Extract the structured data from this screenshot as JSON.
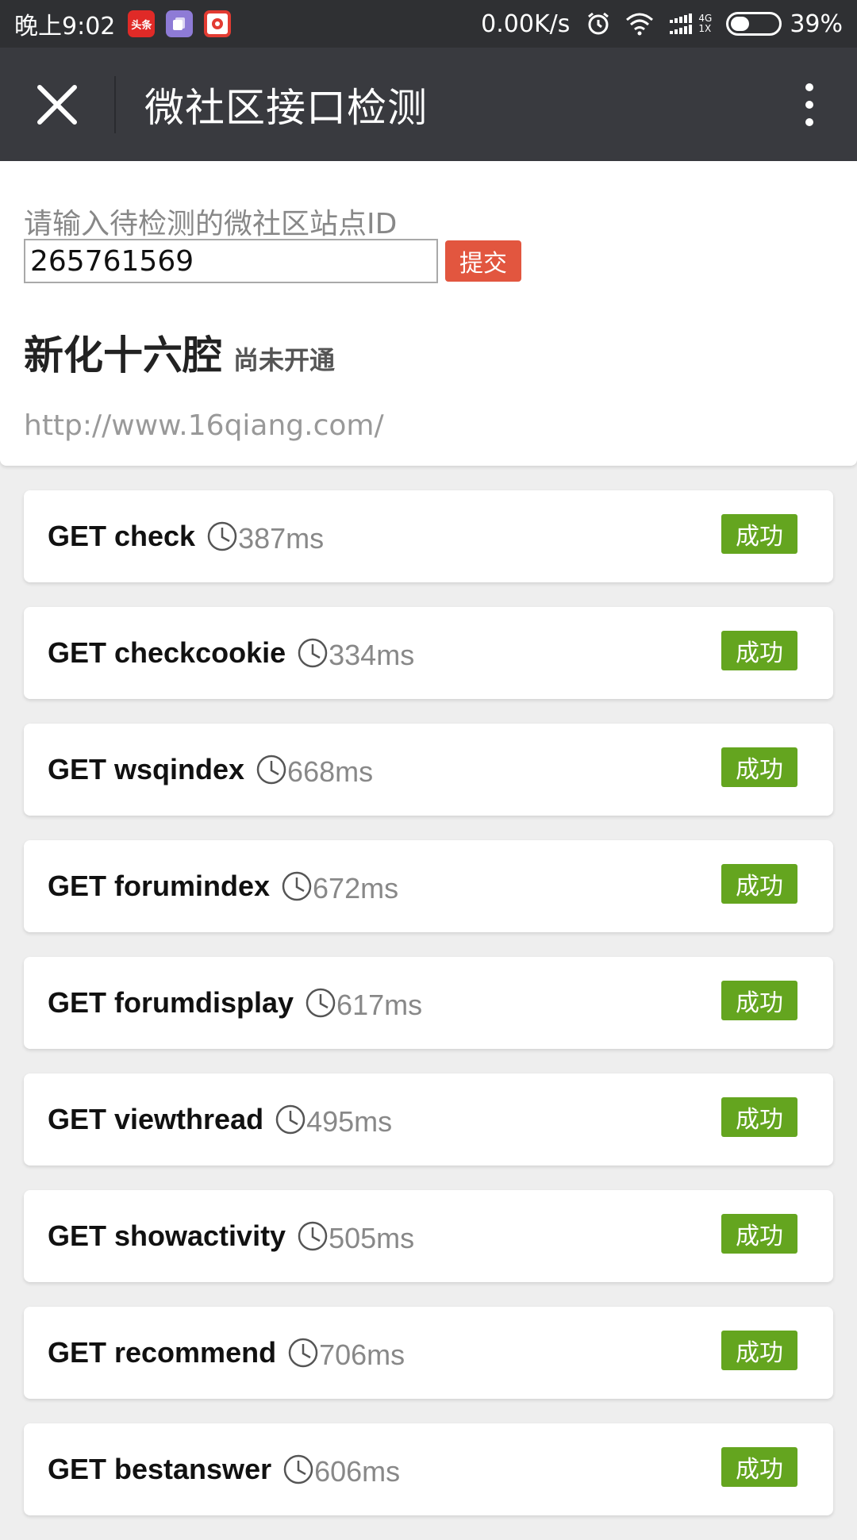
{
  "status_bar": {
    "time": "晚上9:02",
    "net_speed": "0.00K/s",
    "network_type": "4G",
    "sim_label": "1X",
    "battery": "39%",
    "battery_level": 0.39,
    "toutiao_label": "头条"
  },
  "titlebar": {
    "title": "微社区接口检测"
  },
  "form": {
    "prompt": "请输入待检测的微社区站点ID",
    "site_id": "265761569",
    "submit_label": "提交"
  },
  "site": {
    "name": "新化十六腔",
    "status": "尚未开通",
    "url": "http://www.16qiang.com/"
  },
  "checks": [
    {
      "name": "GET check",
      "time": "387ms",
      "status": "成功"
    },
    {
      "name": "GET checkcookie",
      "time": "334ms",
      "status": "成功"
    },
    {
      "name": "GET wsqindex",
      "time": "668ms",
      "status": "成功"
    },
    {
      "name": "GET forumindex",
      "time": "672ms",
      "status": "成功"
    },
    {
      "name": "GET forumdisplay",
      "time": "617ms",
      "status": "成功"
    },
    {
      "name": "GET viewthread",
      "time": "495ms",
      "status": "成功"
    },
    {
      "name": "GET showactivity",
      "time": "505ms",
      "status": "成功"
    },
    {
      "name": "GET recommend",
      "time": "706ms",
      "status": "成功"
    },
    {
      "name": "GET bestanswer",
      "time": "606ms",
      "status": "成功"
    }
  ],
  "colors": {
    "statusbar_bg": "#2f3033",
    "titlebar_bg": "#393a3f",
    "submit_bg": "#e2563f",
    "success_bg": "#64a51f",
    "page_bg": "#eeeeee"
  }
}
